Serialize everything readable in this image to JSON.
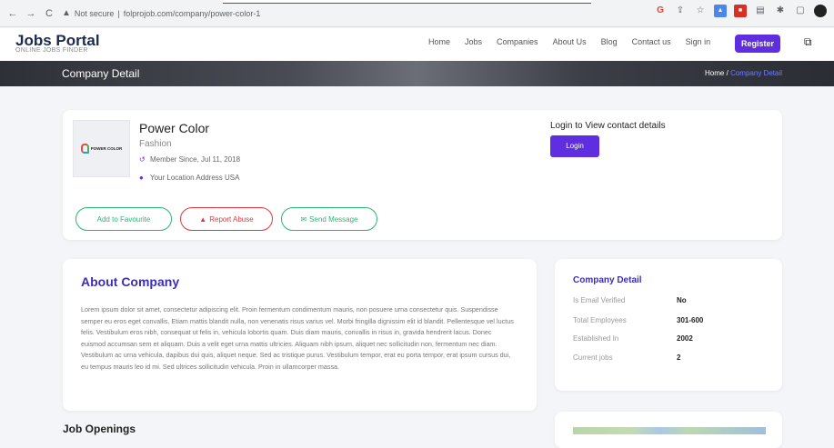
{
  "browser": {
    "back": "←",
    "forward": "→",
    "reload": "C",
    "security_label": "Not secure",
    "url": "folprojob.com/company/power-color-1"
  },
  "header": {
    "logo_title": "Jobs Portal",
    "logo_subtitle": "ONLINE JOBS FINDER",
    "menu": [
      "Home",
      "Jobs",
      "Companies",
      "About Us",
      "Blog",
      "Contact us",
      "Sign in"
    ],
    "register": "Register"
  },
  "banner": {
    "title": "Company Detail",
    "breadcrumb_home": "Home",
    "breadcrumb_sep": "/",
    "breadcrumb_current": "Company Detail"
  },
  "company": {
    "logo_text": "POWER COLOR",
    "name": "Power Color",
    "category": "Fashion",
    "member_since": "Member Since, Jul 11, 2018",
    "location": "Your Location Address USA",
    "actions": {
      "favourite": "Add to Favourite",
      "report": "Report Abuse",
      "message": "Send Message"
    },
    "login_title": "Login to View contact details",
    "login_button": "Login"
  },
  "about": {
    "title": "About Company",
    "text": "Lorem ipsum dolor sit amet, consectetur adipiscing elit. Proin fermentum condimentum mauris, non posuere urna consectetur quis. Suspendisse semper eu eros eget convallis. Etiam mattis blandit nulla, non venenatis risus varius vel. Morbi fringilla dignissim elit id blandit. Pellentesque vel luctus felis. Vestibulum eros nibh, consequat ut felis in, vehicula lobortis quam. Duis diam mauris, convallis in risus in, gravida hendrerit lacus. Donec euismod accumsan sem et aliquam. Duis a velit eget urna mattis ultricies. Aliquam nibh ipsum, aliquet nec sollicitudin non, fermentum nec diam. Vestibulum ac urna vehicula, dapibus dui quis, aliquet neque. Sed ac tristique purus. Vestibulum tempor, erat eu porta tempor, erat ipsum cursus dui, eu tempus mauris leo id mi. Sed ultrices sollicitudin vehicula. Proin in ullamcorper massa."
  },
  "detail": {
    "title": "Company Detail",
    "rows": [
      {
        "label": "Is Email Verified",
        "value": "No"
      },
      {
        "label": "Total Employees",
        "value": "301-600"
      },
      {
        "label": "Established In",
        "value": "2002"
      },
      {
        "label": "Current jobs",
        "value": "2"
      }
    ]
  },
  "jobs_title": "Job Openings",
  "colors": {
    "accent": "#5e2ee0",
    "heading": "#3b2fb8",
    "success": "#2bb673",
    "danger": "#e0393e"
  }
}
